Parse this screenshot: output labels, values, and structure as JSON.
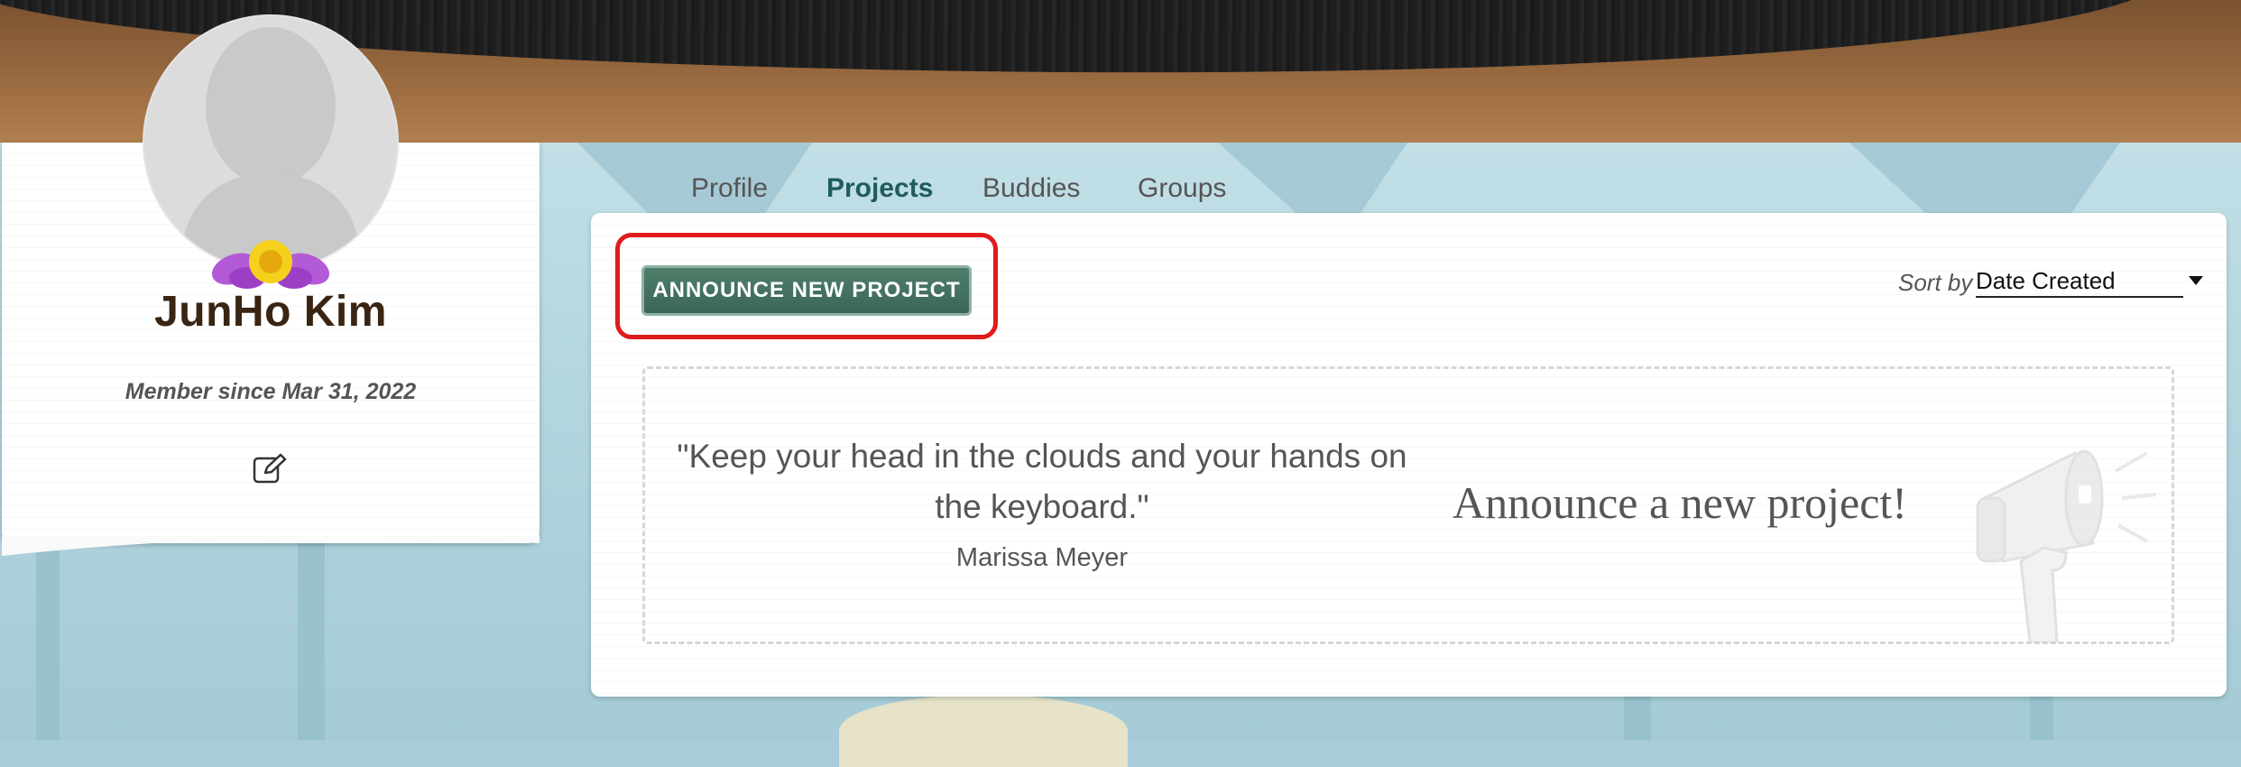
{
  "banner": {
    "image": "banner-fabric-on-wood"
  },
  "profile": {
    "name": "JunHo Kim",
    "member_since": "Member since Mar 31, 2022",
    "avatar_icon": "default-avatar-silhouette",
    "badge_icon": "flower-badge-icon",
    "edit_icon": "edit-icon"
  },
  "tabs": [
    {
      "label": "Profile",
      "active": false
    },
    {
      "label": "Projects",
      "active": true
    },
    {
      "label": "Buddies",
      "active": false
    },
    {
      "label": "Groups",
      "active": false
    }
  ],
  "projects": {
    "announce_button": "ANNOUNCE NEW PROJECT",
    "sort": {
      "label": "Sort by",
      "value": "Date Created"
    },
    "empty_state": {
      "quote": "\"Keep your head in the clouds and your hands on the keyboard.\"",
      "author": "Marissa Meyer",
      "cta": "Announce a new project!",
      "icon": "megaphone-icon"
    }
  },
  "colors": {
    "accent": "#1f5c5a",
    "button": "#3f6e5c",
    "highlight": "#e01b1b",
    "name": "#3a2412"
  }
}
